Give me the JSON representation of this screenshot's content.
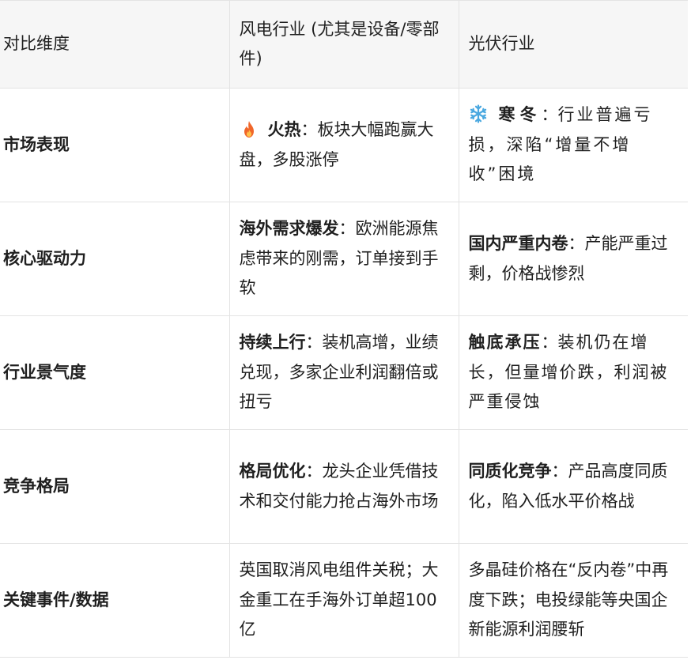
{
  "table": {
    "headers": [
      "对比维度",
      "风电行业 (尤其是设备/零部件)",
      "光伏行业"
    ],
    "rows": [
      {
        "dimension": "市场表现",
        "wind": {
          "icon": "fire-icon",
          "keyword": "火热",
          "sep": "：",
          "text": "板块大幅跑赢大盘，多股涨停"
        },
        "pv": {
          "icon": "snowflake-icon",
          "keyword": "寒冬",
          "sep": "：",
          "text": "行业普遍亏损，深陷“增量不增收”困境"
        }
      },
      {
        "dimension": "核心驱动力",
        "wind": {
          "keyword": "海外需求爆发",
          "sep": "：",
          "text": "欧洲能源焦虑带来的刚需，订单接到手软"
        },
        "pv": {
          "keyword": "国内严重内卷",
          "sep": "：",
          "text": "产能严重过剩，价格战惨烈"
        }
      },
      {
        "dimension": "行业景气度",
        "wind": {
          "keyword": "持续上行",
          "sep": "：",
          "text": "装机高增，业绩兑现，多家企业利润翻倍或扭亏"
        },
        "pv": {
          "keyword": "触底承压",
          "sep": "：",
          "text": "装机仍在增长，但量增价跌，利润被严重侵蚀"
        }
      },
      {
        "dimension": "竞争格局",
        "wind": {
          "keyword": "格局优化",
          "sep": "：",
          "text": "龙头企业凭借技术和交付能力抢占海外市场"
        },
        "pv": {
          "keyword": "同质化竞争",
          "sep": "：",
          "text": "产品高度同质化，陷入低水平价格战"
        }
      },
      {
        "dimension": "关键事件/数据",
        "wind": {
          "text": "英国取消风电组件关税；大金重工在手海外订单超100亿"
        },
        "pv": {
          "text": "多晶硅价格在“反内卷”中再度下跌；电投绿能等央国企新能源利润腰斩"
        }
      }
    ]
  },
  "colors": {
    "header_bg": "#f6f6f6",
    "border": "#e3e3e3",
    "text": "#1f1f1f",
    "fire": "#f0662a",
    "snow": "#4aa8e0"
  }
}
